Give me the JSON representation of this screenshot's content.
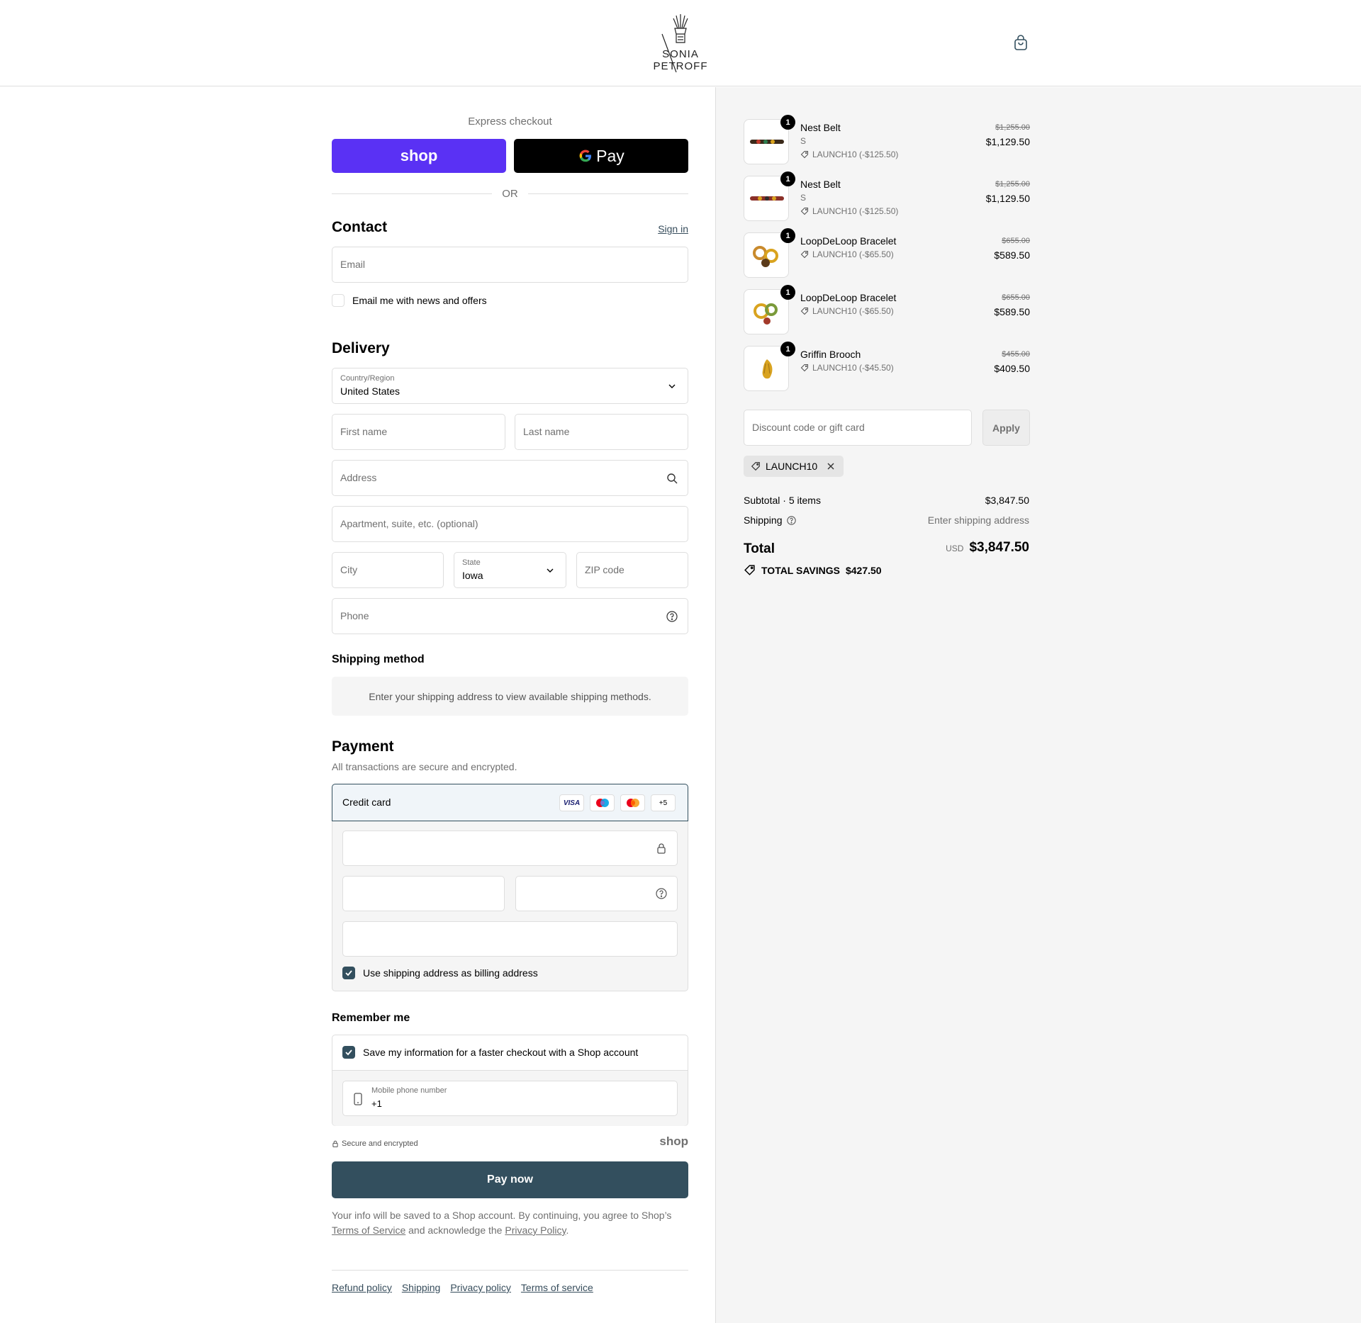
{
  "brand": {
    "name": "SONIA PETROFF"
  },
  "express": {
    "label": "Express checkout",
    "shop_label": "shop",
    "gpay_label": "Pay",
    "or_label": "OR"
  },
  "contact": {
    "title": "Contact",
    "sign_in": "Sign in",
    "email_placeholder": "Email",
    "news_label": "Email me with news and offers"
  },
  "delivery": {
    "title": "Delivery",
    "country_label": "Country/Region",
    "country_value": "United States",
    "first_name": "First name",
    "last_name": "Last name",
    "address": "Address",
    "apartment": "Apartment, suite, etc. (optional)",
    "city": "City",
    "state_label": "State",
    "state_value": "Iowa",
    "zip": "ZIP code",
    "phone": "Phone"
  },
  "shipping_method": {
    "title": "Shipping method",
    "message": "Enter your shipping address to view available shipping methods."
  },
  "payment": {
    "title": "Payment",
    "subtitle": "All transactions are secure and encrypted.",
    "method_label": "Credit card",
    "cards": [
      "VISA",
      "maestro",
      "mastercard",
      "+5"
    ],
    "billing_label": "Use shipping address as billing address"
  },
  "remember": {
    "title": "Remember me",
    "save_label": "Save my information for a faster checkout with a Shop account",
    "phone_label": "Mobile phone number",
    "phone_value": "+1",
    "secure_label": "Secure and encrypted",
    "shop_logo": "shop"
  },
  "pay_button": "Pay now",
  "legal": {
    "before": "Your info will be saved to a Shop account. By continuing, you agree to Shop’s",
    "terms": "Terms of Service",
    "mid": "and acknowledge the",
    "privacy": "Privacy Policy",
    "end": "."
  },
  "footer_links": [
    "Refund policy",
    "Shipping",
    "Privacy policy",
    "Terms of service"
  ],
  "items": [
    {
      "name": "Nest Belt",
      "variant": "S",
      "discount": "LAUNCH10 (-$125.50)",
      "old_price": "$1,255.00",
      "price": "$1,129.50",
      "qty": "1"
    },
    {
      "name": "Nest Belt",
      "variant": "S",
      "discount": "LAUNCH10 (-$125.50)",
      "old_price": "$1,255.00",
      "price": "$1,129.50",
      "qty": "1"
    },
    {
      "name": "LoopDeLoop Bracelet",
      "variant": "",
      "discount": "LAUNCH10 (-$65.50)",
      "old_price": "$655.00",
      "price": "$589.50",
      "qty": "1"
    },
    {
      "name": "LoopDeLoop Bracelet",
      "variant": "",
      "discount": "LAUNCH10 (-$65.50)",
      "old_price": "$655.00",
      "price": "$589.50",
      "qty": "1"
    },
    {
      "name": "Griffin Brooch",
      "variant": "",
      "discount": "LAUNCH10 (-$45.50)",
      "old_price": "$455.00",
      "price": "$409.50",
      "qty": "1"
    }
  ],
  "discount": {
    "placeholder": "Discount code or gift card",
    "apply": "Apply",
    "code": "LAUNCH10"
  },
  "summary": {
    "subtotal_label": "Subtotal · 5 items",
    "subtotal": "$3,847.50",
    "shipping_label": "Shipping",
    "shipping_value": "Enter shipping address",
    "total_label": "Total",
    "currency": "USD",
    "total": "$3,847.50",
    "savings_label": "TOTAL SAVINGS",
    "savings": "$427.50"
  },
  "colors": {
    "shop_purple": "#5a31f4",
    "accent": "#334f5e",
    "sidebar_bg": "#f5f5f5"
  }
}
